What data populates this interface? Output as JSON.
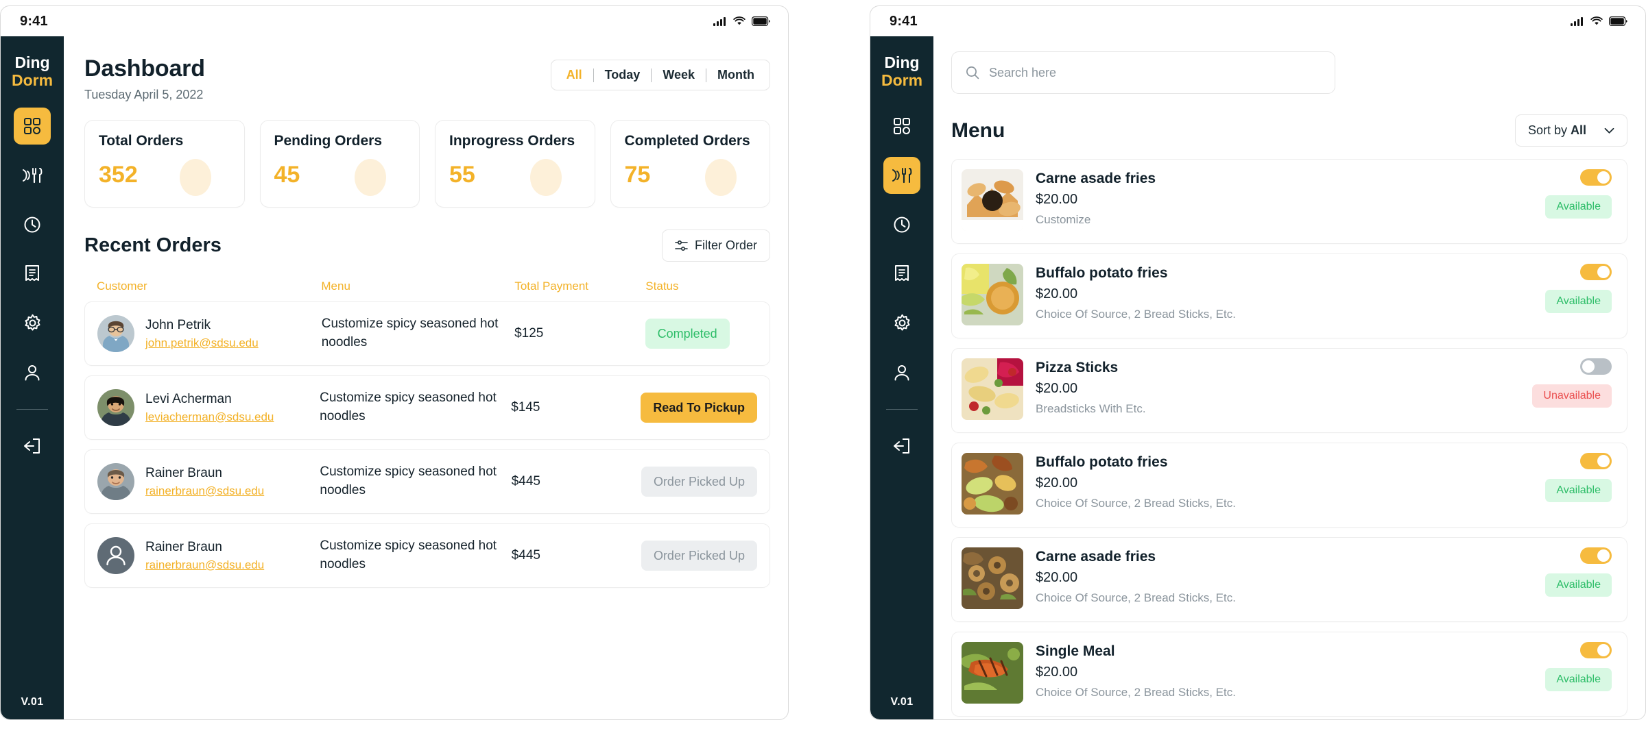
{
  "theme": {
    "accent": "#f6bb3f",
    "sidebar_bg": "#11272f",
    "text_dark": "#12212b",
    "green": "#2dbd68",
    "red": "#ea4f4f"
  },
  "left_panel": {
    "status_bar": {
      "time": "9:41"
    },
    "sidebar": {
      "brand_line1": "Ding",
      "brand_line2": "Dorm",
      "version": "V.01",
      "items": [
        {
          "name": "dashboard",
          "icon": "grid-icon",
          "active": true
        },
        {
          "name": "menu",
          "icon": "cutlery-icon",
          "active": false
        },
        {
          "name": "history",
          "icon": "clock-icon",
          "active": false
        },
        {
          "name": "orders",
          "icon": "receipt-icon",
          "active": false
        },
        {
          "name": "settings",
          "icon": "gear-icon",
          "active": false
        },
        {
          "name": "profile",
          "icon": "user-icon",
          "active": false
        }
      ],
      "logout": {
        "name": "logout",
        "icon": "logout-icon"
      }
    },
    "header": {
      "title": "Dashboard",
      "date": "Tuesday April 5, 2022"
    },
    "range_tabs": [
      {
        "label": "All",
        "active": true
      },
      {
        "label": "Today",
        "active": false
      },
      {
        "label": "Week",
        "active": false
      },
      {
        "label": "Month",
        "active": false
      }
    ],
    "stats": [
      {
        "label": "Total Orders",
        "value": "352"
      },
      {
        "label": "Pending Orders",
        "value": "45"
      },
      {
        "label": "Inprogress Orders",
        "value": "55"
      },
      {
        "label": "Completed Orders",
        "value": "75"
      }
    ],
    "recent_orders": {
      "title": "Recent Orders",
      "filter_label": "Filter Order",
      "columns": [
        "Customer",
        "Menu",
        "Total Payment",
        "Status"
      ],
      "rows": [
        {
          "name": "John Petrik",
          "email": "john.petrik@sdsu.edu",
          "menu": "Customize spicy seasoned hot noodles",
          "payment": "$125",
          "status": "Completed",
          "status_type": "completed",
          "avatar_type": "photo-1"
        },
        {
          "name": "Levi Acherman",
          "email": "leviacherman@sdsu.edu",
          "menu": "Customize spicy seasoned hot noodles",
          "payment": "$145",
          "status": "Read To Pickup",
          "status_type": "pickup",
          "avatar_type": "photo-2"
        },
        {
          "name": "Rainer Braun",
          "email": "rainerbraun@sdsu.edu",
          "menu": "Customize spicy seasoned hot noodles",
          "payment": "$445",
          "status": "Order Picked Up",
          "status_type": "picked",
          "avatar_type": "photo-3"
        },
        {
          "name": "Rainer Braun",
          "email": "rainerbraun@sdsu.edu",
          "menu": "Customize spicy seasoned hot noodles",
          "payment": "$445",
          "status": "Order Picked Up",
          "status_type": "picked",
          "avatar_type": "placeholder"
        }
      ]
    }
  },
  "right_panel": {
    "status_bar": {
      "time": "9:41"
    },
    "sidebar": {
      "brand_line1": "Ding",
      "brand_line2": "Dorm",
      "version": "V.01",
      "items": [
        {
          "name": "dashboard",
          "icon": "grid-icon",
          "active": false
        },
        {
          "name": "menu",
          "icon": "cutlery-icon",
          "active": true
        },
        {
          "name": "history",
          "icon": "clock-icon",
          "active": false
        },
        {
          "name": "orders",
          "icon": "receipt-icon",
          "active": false
        },
        {
          "name": "settings",
          "icon": "gear-icon",
          "active": false
        },
        {
          "name": "profile",
          "icon": "user-icon",
          "active": false
        }
      ],
      "logout": {
        "name": "logout",
        "icon": "logout-icon"
      }
    },
    "search": {
      "placeholder": "Search here",
      "value": ""
    },
    "menu_header": {
      "title": "Menu",
      "sort_prefix": "Sort by",
      "sort_value": "All"
    },
    "menu_items": [
      {
        "name": "Carne asade fries",
        "price": "$20.00",
        "desc": "Customize",
        "available": true,
        "badge": "Available",
        "thumb": "fries-sauce"
      },
      {
        "name": "Buffalo potato fries",
        "price": "$20.00",
        "desc": "Choice Of Source, 2 Bread Sticks, Etc.",
        "available": true,
        "badge": "Available",
        "thumb": "yellow-plate"
      },
      {
        "name": "Pizza Sticks",
        "price": "$20.00",
        "desc": "Breadsticks With Etc.",
        "available": false,
        "badge": "Unavailable",
        "thumb": "pasta-red"
      },
      {
        "name": "Buffalo potato fries",
        "price": "$20.00",
        "desc": "Choice Of Source, 2 Bread Sticks, Etc.",
        "available": true,
        "badge": "Available",
        "thumb": "veggie-mix"
      },
      {
        "name": "Carne asade fries",
        "price": "$20.00",
        "desc": "Choice Of Source, 2 Bread Sticks, Etc.",
        "available": true,
        "badge": "Available",
        "thumb": "mushroom-dish"
      },
      {
        "name": "Single Meal",
        "price": "$20.00",
        "desc": "Choice Of Source, 2 Bread Sticks, Etc.",
        "available": true,
        "badge": "Available",
        "thumb": "salmon-greens"
      }
    ]
  }
}
